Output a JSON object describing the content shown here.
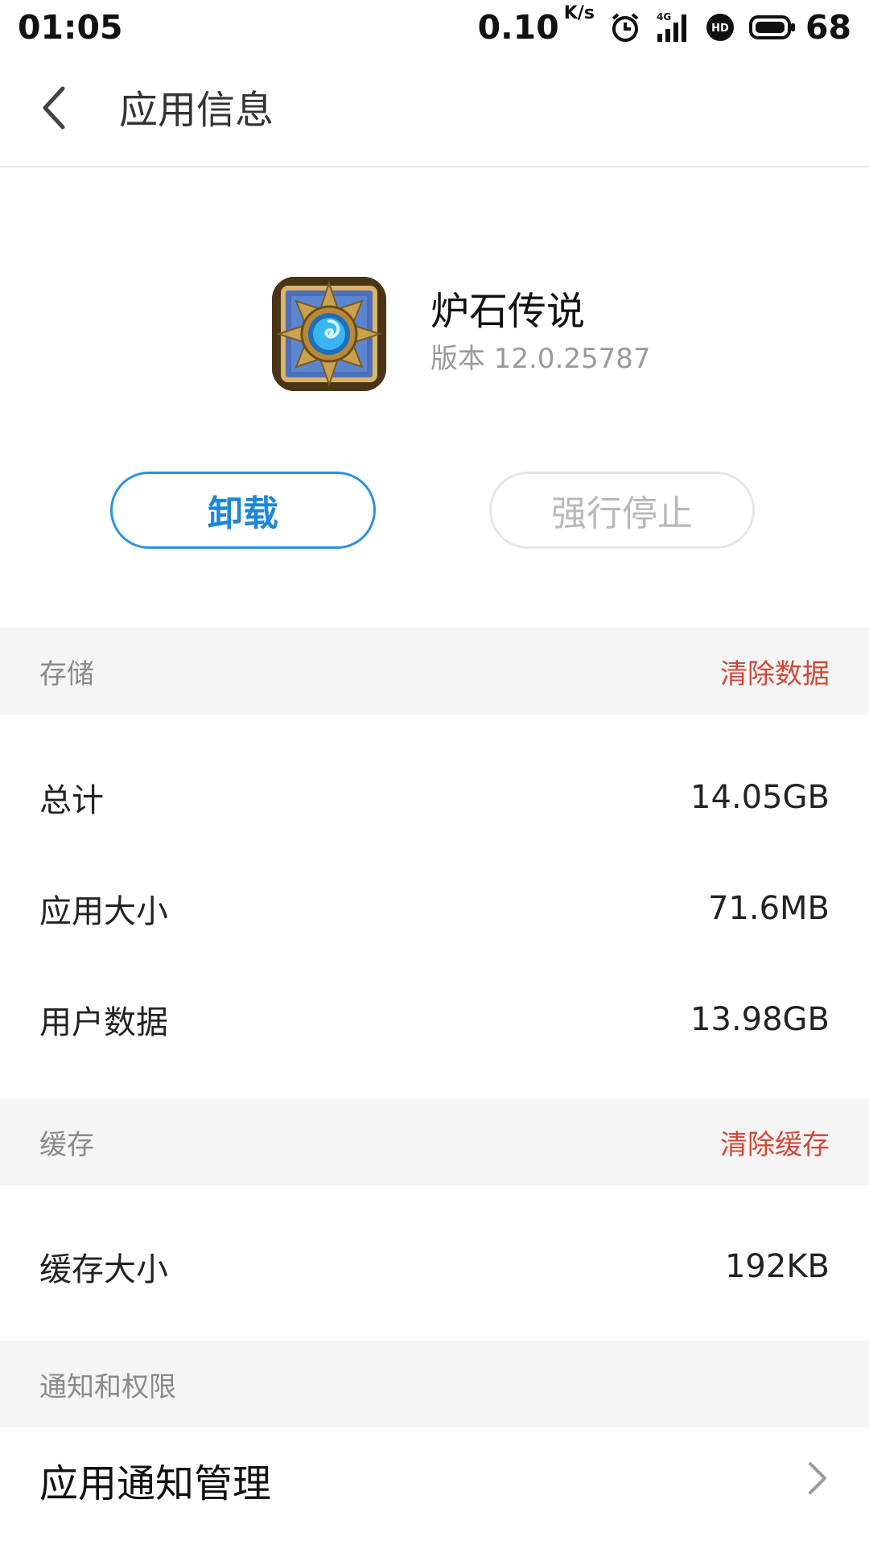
{
  "status_bar": {
    "time": "01:05",
    "net_speed": "0.10",
    "net_unit": "K/s",
    "network_type": "4G",
    "hd_badge": "HD",
    "battery": "68",
    "icons": [
      "alarm-icon",
      "signal-4g-icon",
      "hd-icon",
      "battery-icon"
    ]
  },
  "header": {
    "back_icon": "chevron-left-icon",
    "title": "应用信息"
  },
  "app": {
    "name": "炉石传说",
    "version": "版本 12.0.25787",
    "icon": "hearthstone-app-icon"
  },
  "actions": {
    "uninstall": "卸载",
    "force_stop": "强行停止"
  },
  "storage": {
    "section_title": "存储",
    "clear_action": "清除数据",
    "rows": [
      {
        "label": "总计",
        "value": "14.05GB"
      },
      {
        "label": "应用大小",
        "value": "71.6MB"
      },
      {
        "label": "用户数据",
        "value": "13.98GB"
      }
    ]
  },
  "cache": {
    "section_title": "缓存",
    "clear_action": "清除缓存",
    "rows": [
      {
        "label": "缓存大小",
        "value": "192KB"
      }
    ]
  },
  "notifications": {
    "section_title": "通知和权限",
    "items": [
      {
        "label": "应用通知管理",
        "icon": "chevron-right-icon"
      }
    ]
  },
  "colors": {
    "accent_blue": "#1f86da",
    "danger_red": "#d04a3a",
    "section_bg": "#f5f5f5"
  }
}
